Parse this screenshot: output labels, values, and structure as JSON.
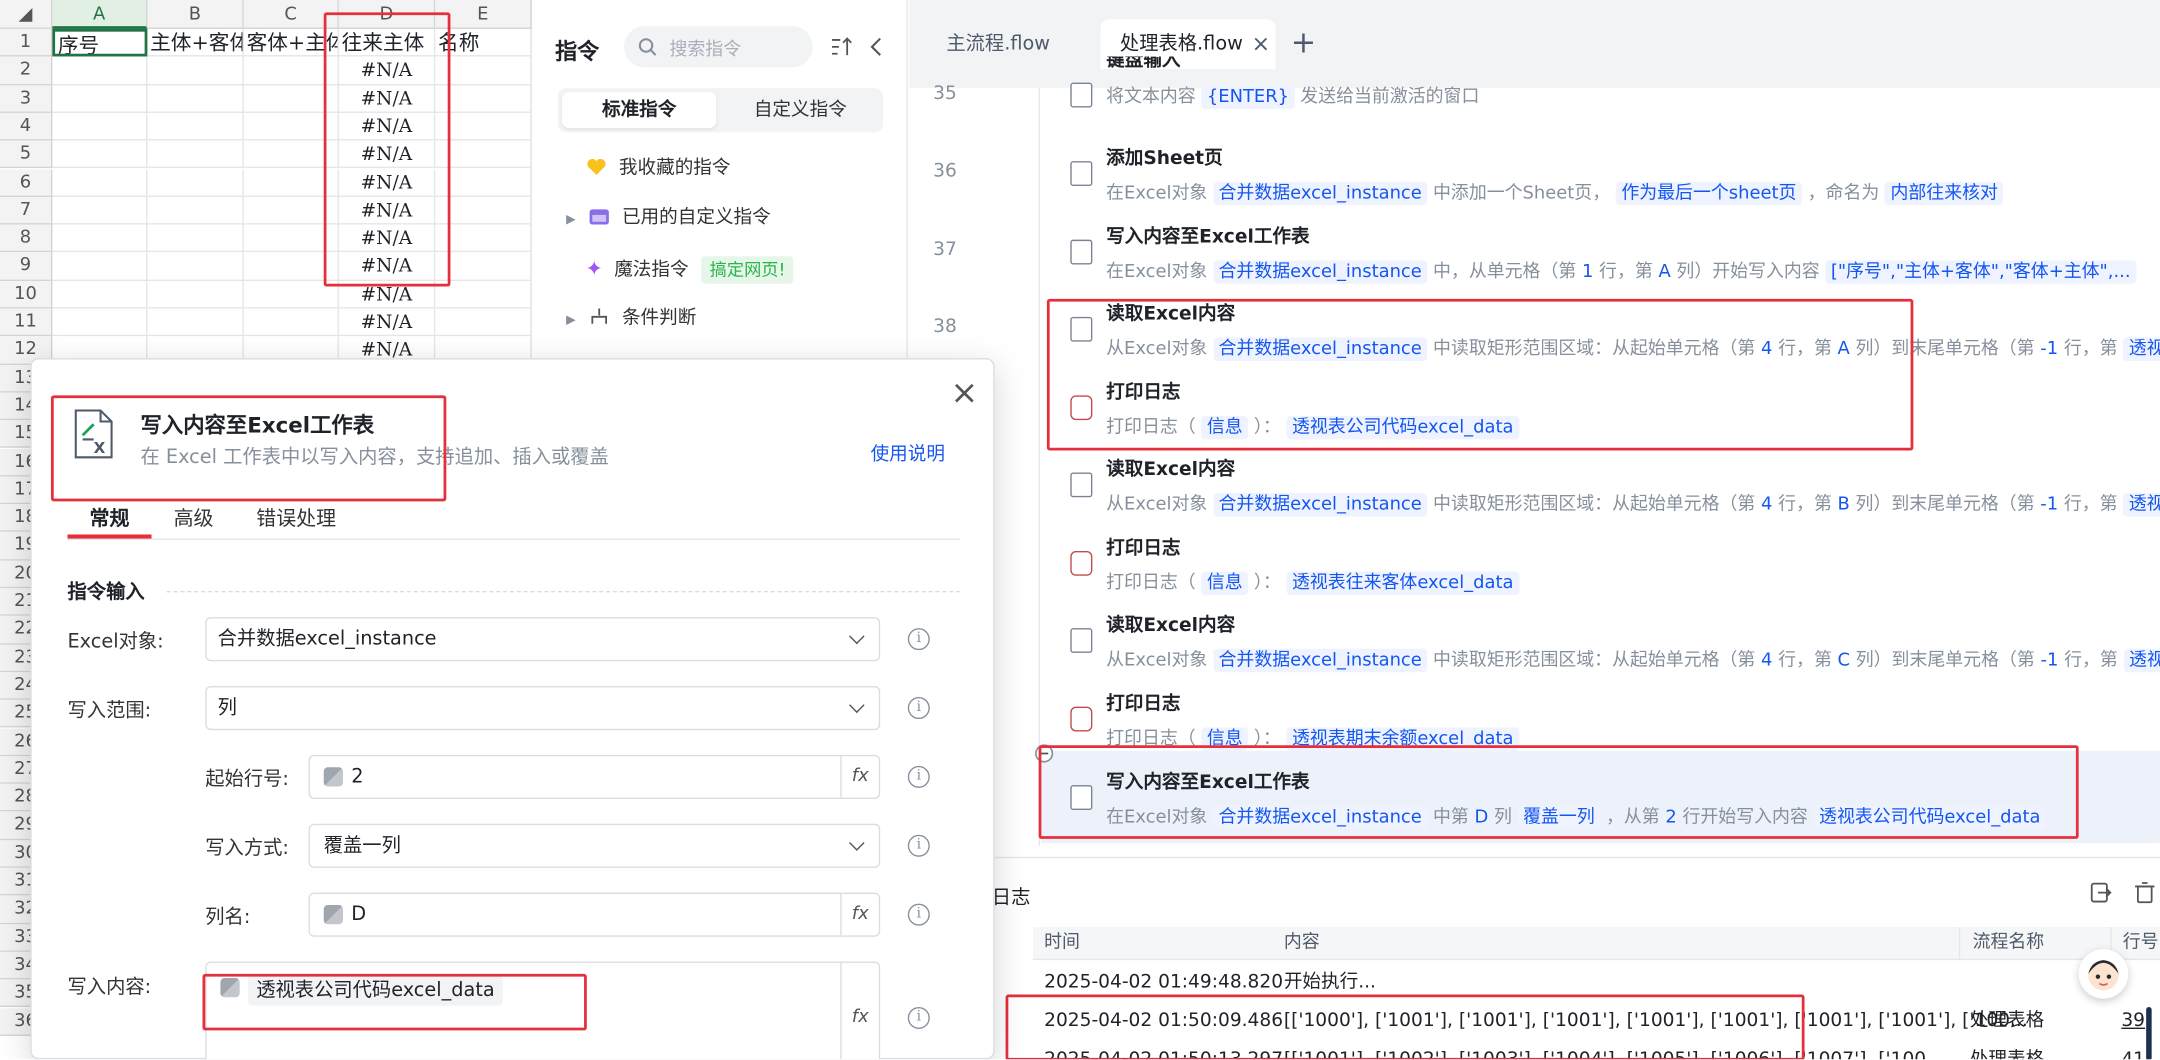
{
  "spreadsheet": {
    "columns": [
      "A",
      "B",
      "C",
      "D",
      "E"
    ],
    "rows": [
      "1",
      "2",
      "3",
      "4",
      "5",
      "6",
      "7",
      "8",
      "9",
      "10",
      "11",
      "12",
      "13",
      "14",
      "15",
      "16",
      "17",
      "18",
      "19",
      "20",
      "21",
      "22",
      "23",
      "24",
      "25",
      "26",
      "27",
      "28",
      "29",
      "30",
      "31",
      "32",
      "33",
      "34",
      "35",
      "36"
    ],
    "header_cells": [
      "序号",
      "主体+客体",
      "客体+主体",
      "往来主体",
      "名称"
    ],
    "na_value": "#N/A"
  },
  "commands": {
    "title": "指令",
    "search_placeholder": "搜索指令",
    "tab_standard": "标准指令",
    "tab_custom": "自定义指令",
    "favorites": "我收藏的指令",
    "used_custom": "已用的自定义指令",
    "magic": "魔法指令",
    "magic_badge": "搞定网页!",
    "condition": "条件判断"
  },
  "editor": {
    "tabs": [
      "主流程.flow",
      "处理表格.flow"
    ],
    "add_tab": "+",
    "close_icon": "×",
    "line_numbers": [
      "35",
      "36",
      "37",
      "38"
    ],
    "steps": [
      {
        "title": "键盘输入",
        "desc": [
          "将文本内容 ",
          "{ENTER}",
          " 发送给当前激活的窗口"
        ]
      },
      {
        "title": "添加Sheet页",
        "desc": [
          "在Excel对象 ",
          "合并数据excel_instance",
          " 中添加一个Sheet页， ",
          "作为最后一个sheet页",
          " ，命名为 ",
          "内部往来核对"
        ]
      },
      {
        "title": "写入内容至Excel工作表",
        "desc": [
          "在Excel对象 ",
          "合并数据excel_instance",
          " 中，从单元格（第 ",
          "1",
          " 行，第 ",
          "A",
          " 列）开始写入内容 ",
          "[\"序号\",\"主体+客体\",\"客体+主体\",..."
        ]
      },
      {
        "title": "读取Excel内容",
        "desc": [
          "从Excel对象 ",
          "合并数据excel_instance",
          " 中读取矩形范围区域：从起始单元格（第 ",
          "4",
          " 行，第 ",
          "A",
          " 列）到末尾单元格（第 ",
          "-1",
          " 行，第 ",
          "透视"
        ]
      },
      {
        "title": "打印日志",
        "desc": [
          "打印日志（ ",
          "信息",
          " ）：  ",
          "透视表公司代码excel_data"
        ]
      },
      {
        "title": "读取Excel内容",
        "desc": [
          "从Excel对象 ",
          "合并数据excel_instance",
          " 中读取矩形范围区域：从起始单元格（第 ",
          "4",
          " 行，第 ",
          "B",
          " 列）到末尾单元格（第 ",
          "-1",
          " 行，第 ",
          "透视"
        ]
      },
      {
        "title": "打印日志",
        "desc": [
          "打印日志（ ",
          "信息",
          " ）：  ",
          "透视表往来客体excel_data"
        ]
      },
      {
        "title": "读取Excel内容",
        "desc": [
          "从Excel对象 ",
          "合并数据excel_instance",
          " 中读取矩形范围区域：从起始单元格（第 ",
          "4",
          " 行，第 ",
          "C",
          " 列）到末尾单元格（第 ",
          "-1",
          " 行，第 ",
          "透视"
        ]
      },
      {
        "title": "打印日志",
        "desc": [
          "打印日志（ ",
          "信息",
          " ）：  ",
          "透视表期末余额excel_data"
        ]
      },
      {
        "title": "写入内容至Excel工作表",
        "desc": [
          "在Excel对象 ",
          "合并数据excel_instance",
          " 中第 ",
          "D",
          " 列 ",
          "覆盖一列",
          " ，从第 ",
          "2",
          " 行开始写入内容  ",
          "透视表公司代码excel_data"
        ]
      }
    ]
  },
  "log": {
    "title": "日志",
    "headers": [
      "时间",
      "内容",
      "流程名称",
      "行号"
    ],
    "rows": [
      {
        "time": "2025-04-02 01:49:48.820",
        "content": "开始执行...",
        "flow": "",
        "line": ""
      },
      {
        "time": "2025-04-02 01:50:09.486",
        "content": "[['1000'], ['1001'], ['1001'], ['1001'], ['1001'], ['1001'], ['1001'], ['1001'], ['100...",
        "flow": "处理表格",
        "line": "39"
      },
      {
        "time": "2025-04-02 01:50:13.297",
        "content": "[['1001'], ['1002'], ['1003'], ['1004'], ['1005'], ['1006'], ['1007'], ['100...",
        "flow": "处理表格",
        "line": "41"
      }
    ]
  },
  "dialog": {
    "title": "写入内容至Excel工作表",
    "subtitle": "在 Excel 工作表中以写入内容，支持追加、插入或覆盖",
    "help": "使用说明",
    "tabs": [
      "常规",
      "高级",
      "错误处理"
    ],
    "section": "指令输入",
    "labels": {
      "excel": "Excel对象:",
      "range": "写入范围:",
      "start_row": "起始行号:",
      "method": "写入方式:",
      "col": "列名:",
      "content": "写入内容:"
    },
    "values": {
      "excel": "合并数据excel_instance",
      "range": "列",
      "start_row": "2",
      "method": "覆盖一列",
      "col": "D",
      "content": "透视表公司代码excel_data"
    },
    "fx": "fx",
    "info": "i",
    "close": "×"
  }
}
